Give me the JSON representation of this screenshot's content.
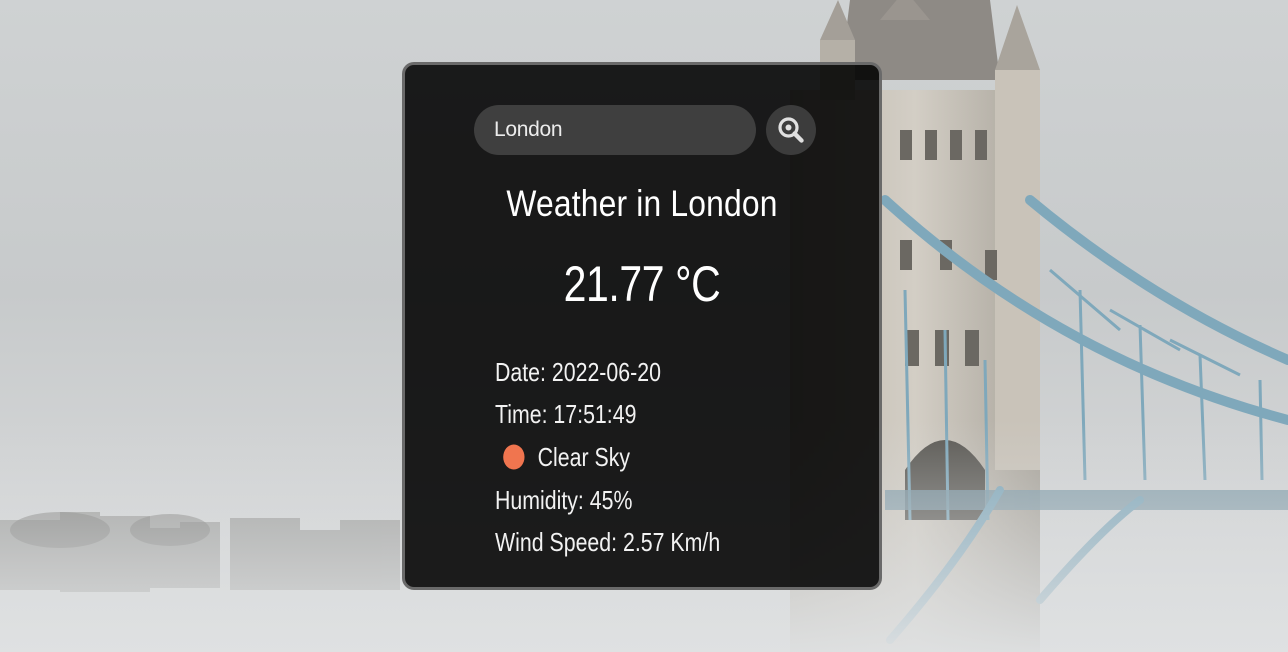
{
  "search": {
    "value": "London",
    "placeholder": "Search",
    "button_icon": "magnifier-zoom-icon"
  },
  "weather": {
    "title": "Weather in London",
    "temperature": "21.77 °C",
    "date_label": "Date: 2022-06-20",
    "time_label": "Time: 17:51:49",
    "condition": "Clear Sky",
    "condition_icon": "sun-icon",
    "humidity_label": "Humidity: 45%",
    "wind_label": "Wind Speed: 2.57 Km/h"
  },
  "colors": {
    "card_background": "#111111",
    "input_background": "#3f3f3f",
    "sun_color": "#f0754f",
    "bridge_blue": "#7fa8bb"
  }
}
